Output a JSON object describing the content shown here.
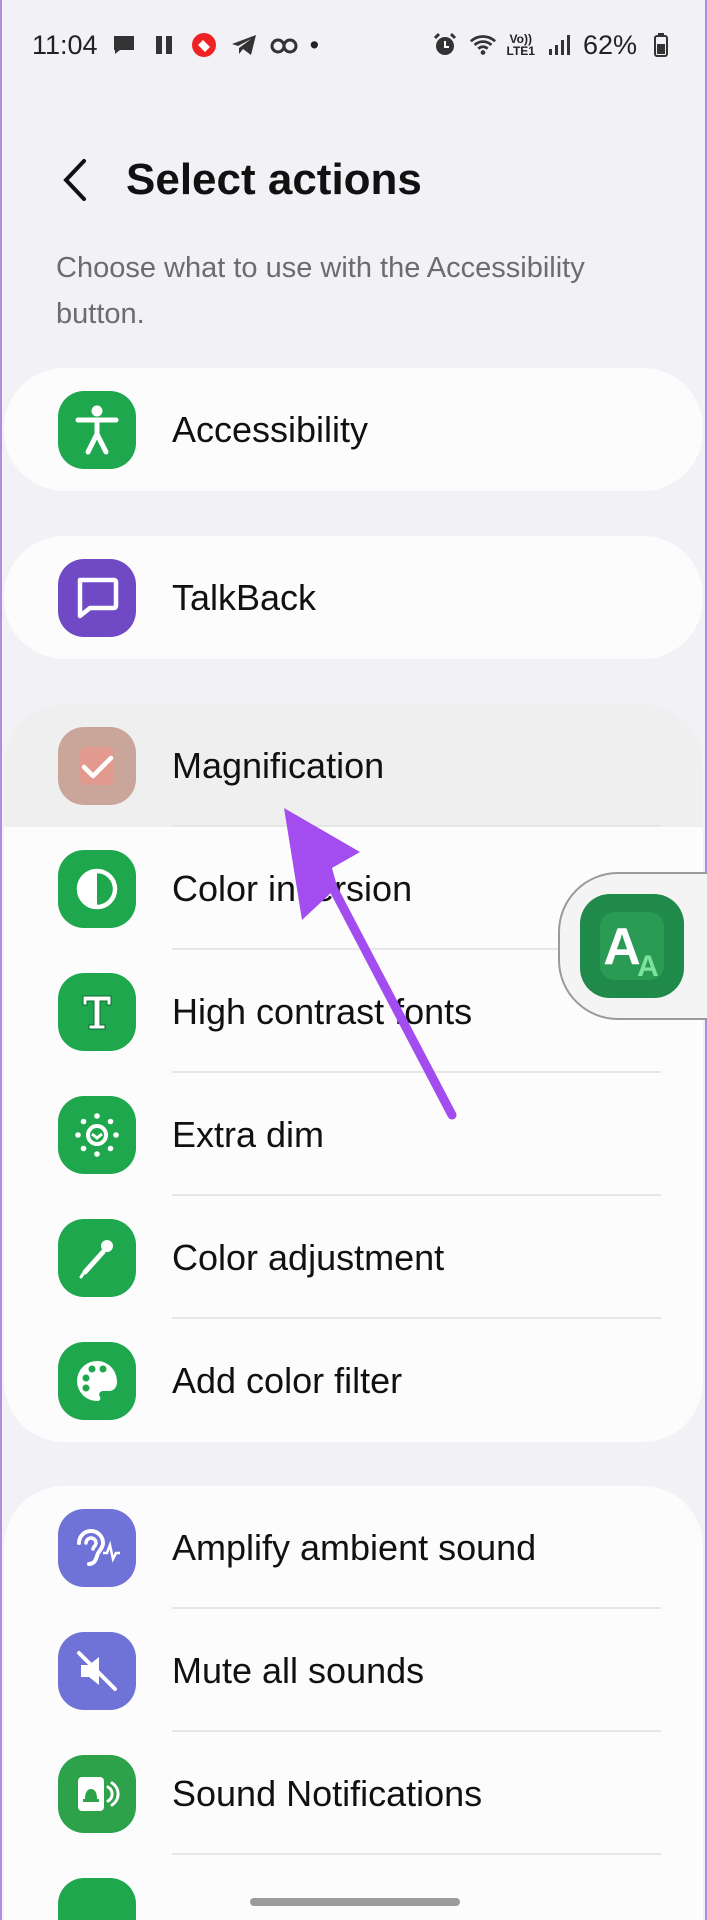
{
  "status_bar": {
    "time": "11:04",
    "battery": "62%",
    "network_label_top": "Vo))",
    "network_label_bottom": "LTE1",
    "dot": "•"
  },
  "header": {
    "title": "Select actions",
    "back_icon": "chevron-left-icon"
  },
  "subtitle": "Choose what to use with the Accessibility button.",
  "groups": [
    {
      "items": [
        {
          "label": "Accessibility",
          "icon": "accessibility-icon",
          "color": "#1fa74e"
        }
      ]
    },
    {
      "items": [
        {
          "label": "TalkBack",
          "icon": "talkback-icon",
          "color": "#6f4ac4"
        }
      ]
    },
    {
      "items": [
        {
          "label": "Magnification",
          "icon": "magnification-icon",
          "color": "#c9a59a",
          "selected": true
        },
        {
          "label": "Color inversion",
          "icon": "color-inversion-icon",
          "color": "#1fa74e"
        },
        {
          "label": "High contrast fonts",
          "icon": "high-contrast-fonts-icon",
          "color": "#1fa74e"
        },
        {
          "label": "Extra dim",
          "icon": "extra-dim-icon",
          "color": "#1fa74e"
        },
        {
          "label": "Color adjustment",
          "icon": "color-adjustment-icon",
          "color": "#1fa74e"
        },
        {
          "label": "Add color filter",
          "icon": "color-filter-icon",
          "color": "#1fa74e"
        }
      ]
    },
    {
      "items": [
        {
          "label": "Amplify ambient sound",
          "icon": "amplify-sound-icon",
          "color": "#6f72d6"
        },
        {
          "label": "Mute all sounds",
          "icon": "mute-icon",
          "color": "#6f72d6"
        },
        {
          "label": "Sound Notifications",
          "icon": "sound-notifications-icon",
          "color": "#2ea24a"
        }
      ]
    }
  ],
  "floating_button": {
    "icon": "accessibility-floating-icon",
    "letter_big": "A",
    "letter_small": "A"
  },
  "annotation": {
    "type": "arrow",
    "color": "#a34cf0"
  }
}
